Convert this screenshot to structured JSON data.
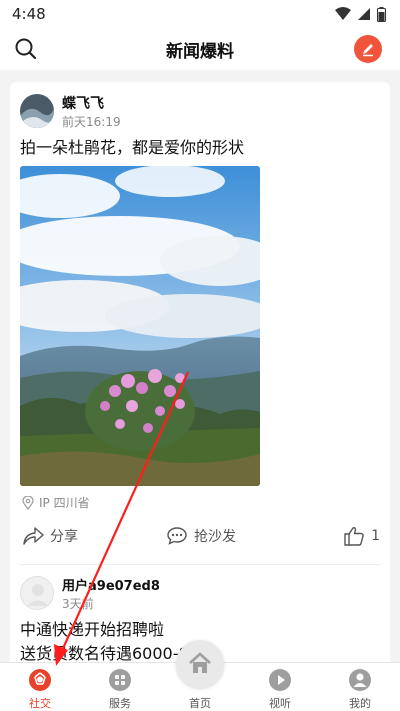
{
  "status_bar": {
    "time": "4:48"
  },
  "header": {
    "title": "新闻爆料"
  },
  "posts": [
    {
      "username": "蝶飞飞",
      "time": "前天16:19",
      "text": "拍一朵杜鹃花，都是爱你的形状",
      "location": "IP 四川省",
      "share_label": "分享",
      "comment_label": "抢沙发",
      "like_count": "1"
    },
    {
      "username": "用户a9e07ed8",
      "time": "3天前",
      "text_line1": "中通快递开始招聘啦",
      "text_line2": "送货员数名待遇6000-8000"
    }
  ],
  "tabbar": {
    "items": [
      {
        "label": "社交",
        "icon": "camera-aperture-icon",
        "active": true
      },
      {
        "label": "服务",
        "icon": "grid-icon"
      },
      {
        "label": "首页",
        "icon": "home-icon"
      },
      {
        "label": "视听",
        "icon": "play-icon"
      },
      {
        "label": "我的",
        "icon": "user-icon"
      }
    ]
  },
  "colors": {
    "accent": "#e8412c",
    "compose": "#f0543b"
  }
}
